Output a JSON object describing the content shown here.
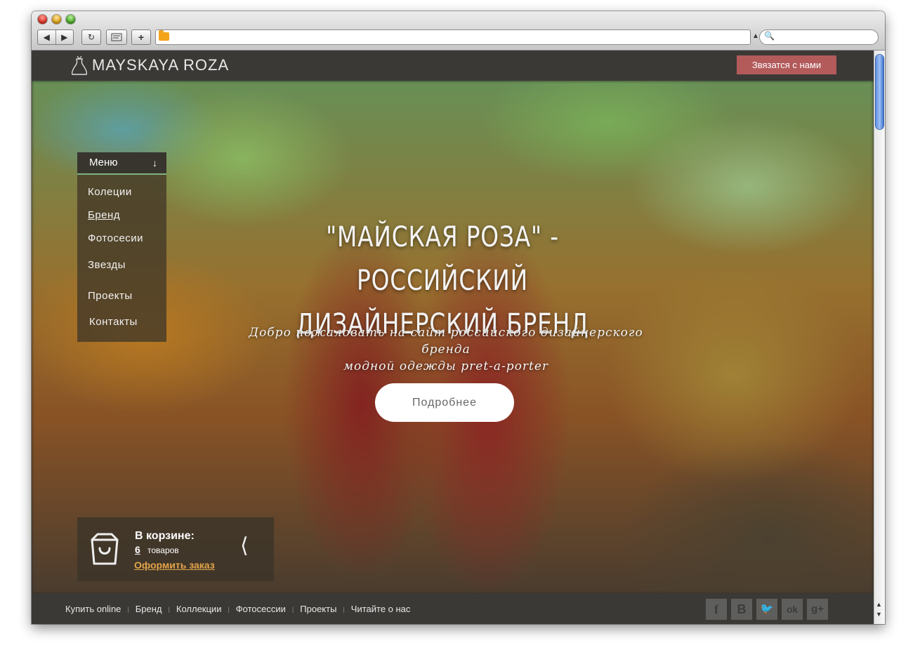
{
  "browser": {
    "back_glyph": "◀",
    "forward_glyph": "▶",
    "reload_glyph": "↻",
    "add_tab_glyph": "+",
    "search_glyph": "🔍",
    "url": ""
  },
  "site": {
    "logo_text": "MAYSKAYA ROZA",
    "contact_label": "Звязатся с нами"
  },
  "menu": {
    "title": "Меню",
    "arrow": "↓",
    "items": [
      {
        "label": "Колеции"
      },
      {
        "label": "Бренд"
      },
      {
        "label": "Фотосесии"
      },
      {
        "label": "Звезды"
      },
      {
        "label": "Проекты"
      },
      {
        "label": "Контакты"
      }
    ],
    "active_index": 1
  },
  "hero": {
    "title_line1": "\"МАЙСКАЯ РОЗА\" - РОССИЙСКИЙ",
    "title_line2": "ДИЗАЙНЕРСКИЙ БРЕНД",
    "subtitle_line1": "Добро пожаловать на сайт российского дизайнерского бренда",
    "subtitle_line2": "модной одежды pret-a-porter",
    "button_label": "Подробнее"
  },
  "cart": {
    "title": "В корзине:",
    "count": "6",
    "goods_label": "товаров",
    "order_label": "Оформить заказ",
    "toggle_glyph": "⟨"
  },
  "footer": {
    "links": [
      "Купить online",
      "Бренд",
      "Коллекции",
      "Фотосессии",
      "Проекты",
      "Читайте о нас"
    ],
    "separator": "|",
    "social": [
      {
        "icon": "facebook-icon",
        "glyph": "f"
      },
      {
        "icon": "vkontakte-icon",
        "glyph": "B"
      },
      {
        "icon": "twitter-icon",
        "glyph": "🐦"
      },
      {
        "icon": "odnoklassniki-icon",
        "glyph": "ok"
      },
      {
        "icon": "google-plus-icon",
        "glyph": "g+"
      }
    ]
  },
  "colors": {
    "topbar": "#3a3936",
    "accent_red": "#b35a5b",
    "menu_accent": "#7fb37a",
    "order_link": "#e3a44a"
  }
}
